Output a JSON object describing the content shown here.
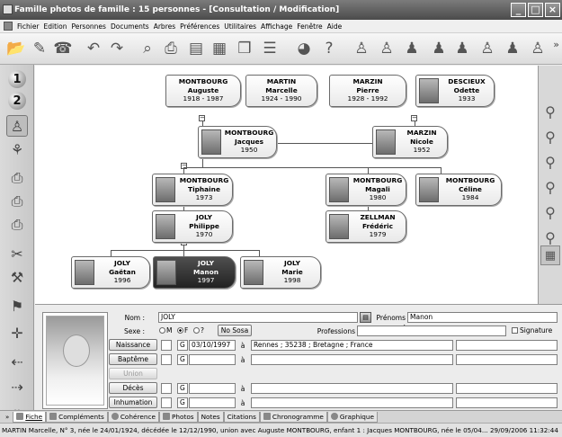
{
  "window": {
    "title": "Famille photos de famille : 15 personnes - [Consultation / Modification]",
    "min_glyph": "_",
    "max_glyph": "□",
    "close_glyph": "×"
  },
  "menu": [
    "Fichier",
    "Edition",
    "Personnes",
    "Documents",
    "Arbres",
    "Préférences",
    "Utilitaires",
    "Affichage",
    "Fenêtre",
    "Aide"
  ],
  "toolbar": {
    "icons": [
      "open-folder-icon",
      "edit-icon",
      "phone-icon",
      "undo-icon",
      "redo-icon",
      "search-doc-icon",
      "print-persons-icon",
      "document-icon",
      "notes-icon",
      "book-icon",
      "list-dropdown-icon",
      "palette-icon",
      "help-icon",
      "find-person-icon",
      "add-person-icon",
      "person-icon",
      "descendants-icon",
      "couple-icon",
      "ancestors-icon",
      "group-icon",
      "remove-person-icon"
    ],
    "more": "»"
  },
  "leftbar": {
    "num1": "1",
    "num2": "2"
  },
  "tree": {
    "persons": [
      {
        "id": "p1",
        "name1": "MONTBOURG",
        "name2": "Auguste",
        "dates": "1918 - 1987"
      },
      {
        "id": "p2",
        "name1": "MARTIN",
        "name2": "Marcelle",
        "dates": "1924 - 1990"
      },
      {
        "id": "p3",
        "name1": "MARZIN",
        "name2": "Pierre",
        "dates": "1928 - 1992"
      },
      {
        "id": "p4",
        "name1": "DESCIEUX",
        "name2": "Odette",
        "dates": "1933"
      },
      {
        "id": "p5",
        "name1": "MONTBOURG",
        "name2": "Jacques",
        "dates": "1950"
      },
      {
        "id": "p6",
        "name1": "MARZIN",
        "name2": "Nicole",
        "dates": "1952"
      },
      {
        "id": "p7",
        "name1": "MONTBOURG",
        "name2": "Tiphaine",
        "dates": "1973"
      },
      {
        "id": "p8",
        "name1": "MONTBOURG",
        "name2": "Magali",
        "dates": "1980"
      },
      {
        "id": "p9",
        "name1": "MONTBOURG",
        "name2": "Céline",
        "dates": "1984"
      },
      {
        "id": "p10",
        "name1": "JOLY",
        "name2": "Philippe",
        "dates": "1970"
      },
      {
        "id": "p11",
        "name1": "ZELLMAN",
        "name2": "Frédéric",
        "dates": "1979"
      },
      {
        "id": "p12",
        "name1": "JOLY",
        "name2": "Gaëtan",
        "dates": "1996"
      },
      {
        "id": "p13",
        "name1": "JOLY",
        "name2": "Manon",
        "dates": "1997"
      },
      {
        "id": "p14",
        "name1": "JOLY",
        "name2": "Marie",
        "dates": "1998"
      }
    ],
    "selected": "p13",
    "junction_glyph": "−"
  },
  "detail": {
    "nom_label": "Nom :",
    "nom_value": "JOLY",
    "prenoms_label": "Prénoms :",
    "prenoms_value": "Manon",
    "sexe_label": "Sexe :",
    "sexe_options": [
      "M",
      "F",
      "?"
    ],
    "sexe_selected": "F",
    "nososa_label": "No Sosa",
    "professions_label": "Professions",
    "signature_label": "Signature",
    "events": [
      {
        "label": "Naissance",
        "code": "G",
        "date": "03/10/1997",
        "a": "à",
        "place": "Rennes ; 35238 ; Bretagne ; France",
        "enabled": true
      },
      {
        "label": "Baptême",
        "code": "G",
        "date": "",
        "a": "à",
        "place": "",
        "enabled": true
      },
      {
        "label": "Union",
        "code": "",
        "date": "",
        "a": "",
        "place": "",
        "enabled": false
      },
      {
        "label": "Décès",
        "code": "G",
        "date": "",
        "a": "à",
        "place": "",
        "enabled": true
      },
      {
        "label": "Inhumation",
        "code": "G",
        "date": "",
        "a": "à",
        "place": "",
        "enabled": true
      }
    ]
  },
  "tabs": [
    "Fiche",
    "Compléments",
    "Cohérence",
    "Photos",
    "Notes",
    "Citations",
    "Chronogramme",
    "Graphique"
  ],
  "tabs_active": "Fiche",
  "tabs_scroll": "»",
  "status": "MARTIN Marcelle, N° 3, née le 24/01/1924, décédée le 12/12/1990, union avec Auguste MONTBOURG, enfant 1 : Jacques MONTBOURG, née le 05/04...  29/09/2006 11:32:44"
}
